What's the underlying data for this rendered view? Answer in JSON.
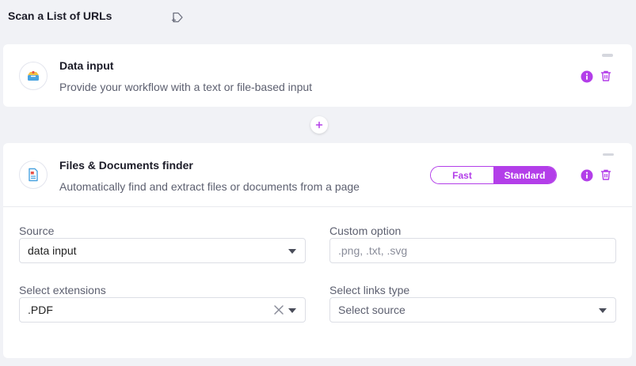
{
  "header": {
    "title": "Scan a List of URLs"
  },
  "steps": [
    {
      "title": "Data input",
      "description": "Provide your workflow with a text or file-based input"
    },
    {
      "title": "Files & Documents finder",
      "description": "Automatically find and extract files or documents from a page",
      "mode_toggle": {
        "options": [
          "Fast",
          "Standard"
        ],
        "selected": "Standard"
      },
      "form": {
        "source": {
          "label": "Source",
          "value": "data input"
        },
        "custom_option": {
          "label": "Custom option",
          "placeholder": ".png, .txt, .svg",
          "value": ""
        },
        "extensions": {
          "label": "Select extensions",
          "value": ".PDF"
        },
        "links_type": {
          "label": "Select links type",
          "placeholder": "Select source"
        }
      }
    }
  ],
  "colors": {
    "accent": "#b33ee9",
    "background": "#f1f2f6",
    "card": "#ffffff"
  },
  "icons": [
    "tag-plus-icon",
    "inbox-tray-icon",
    "document-icon",
    "info-icon",
    "trash-icon",
    "plus-icon",
    "collapse-icon",
    "clear-icon",
    "chevron-down-icon"
  ]
}
